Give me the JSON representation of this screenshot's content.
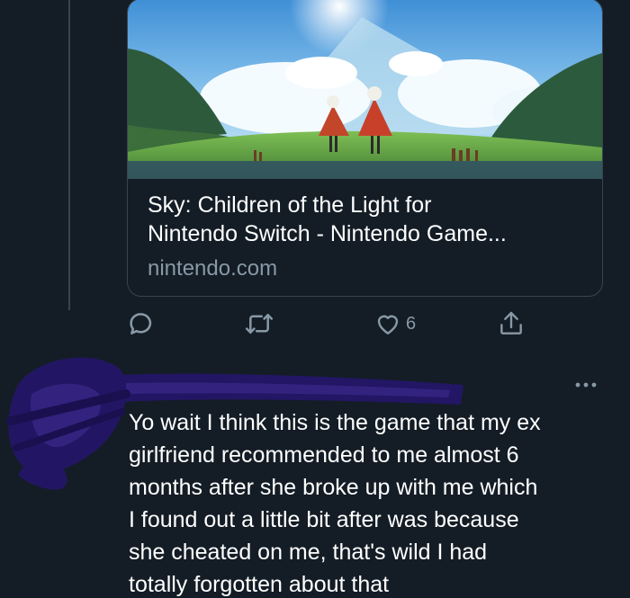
{
  "link_card": {
    "title": "Sky: Children of the Light for\nNintendo Switch - Nintendo Game...",
    "domain": "nintendo.com"
  },
  "actions": {
    "reply_icon": "reply-bubble-icon",
    "retweet_icon": "retweet-icon",
    "like_icon": "heart-icon",
    "like_count": "6",
    "share_icon": "share-icon"
  },
  "reply": {
    "text": "Yo wait I think this is the game that my ex\ngirlfriend recommended to me almost 6\nmonths after she broke up with me which\nI found out a little bit after was because\nshe cheated on me, that's wild I had\ntotally forgotten about that"
  },
  "colors": {
    "background": "#141d26",
    "border": "#38444d",
    "secondary_text": "#8899a6",
    "primary_text": "#ffffff",
    "scribble": "#2a1a6e"
  }
}
